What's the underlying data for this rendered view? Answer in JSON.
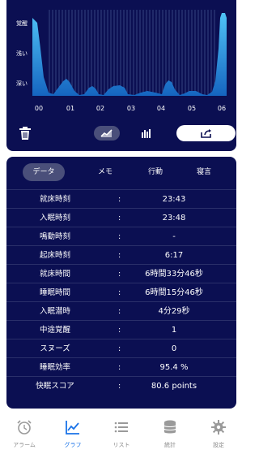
{
  "chart": {
    "y_labels": [
      "覚醒",
      "浅い",
      "深い"
    ],
    "x_labels": [
      "00",
      "01",
      "02",
      "03",
      "04",
      "05",
      "06"
    ]
  },
  "actions": {
    "trash_icon": "trash-icon",
    "line_chart_icon": "line-chart-icon",
    "bar_chart_icon": "bar-chart-icon",
    "share_icon": "share-icon"
  },
  "tabs": [
    "データ",
    "メモ",
    "行動",
    "寝言"
  ],
  "rows": [
    {
      "label": "就床時刻",
      "sep": ":",
      "value": "23:43"
    },
    {
      "label": "入眠時刻",
      "sep": ":",
      "value": "23:48"
    },
    {
      "label": "鳴動時刻",
      "sep": ":",
      "value": "-"
    },
    {
      "label": "起床時刻",
      "sep": ":",
      "value": "6:17"
    },
    {
      "label": "就床時間",
      "sep": ":",
      "value": "6時間33分46秒"
    },
    {
      "label": "睡眠時間",
      "sep": ":",
      "value": "6時間15分46秒"
    },
    {
      "label": "入眠潜時",
      "sep": ":",
      "value": "4分29秒"
    },
    {
      "label": "中途覚醒",
      "sep": ":",
      "value": "1"
    },
    {
      "label": "スヌーズ",
      "sep": ":",
      "value": "0"
    },
    {
      "label": "睡眠効率",
      "sep": ":",
      "value": "95.4 %"
    },
    {
      "label": "快眠スコア",
      "sep": ":",
      "value": "80.6 points"
    }
  ],
  "tabbar": [
    {
      "label": "アラーム",
      "icon": "alarm-icon",
      "active": false
    },
    {
      "label": "グラフ",
      "icon": "graph-icon",
      "active": true
    },
    {
      "label": "リスト",
      "icon": "list-icon",
      "active": false
    },
    {
      "label": "統計",
      "icon": "database-icon",
      "active": false
    },
    {
      "label": "設定",
      "icon": "gear-icon",
      "active": false
    }
  ],
  "colors": {
    "card_bg": "#0b0f52",
    "accent": "#1a73e8",
    "chart_light": "#4fc3f7",
    "chart_dark": "#1565c0"
  }
}
